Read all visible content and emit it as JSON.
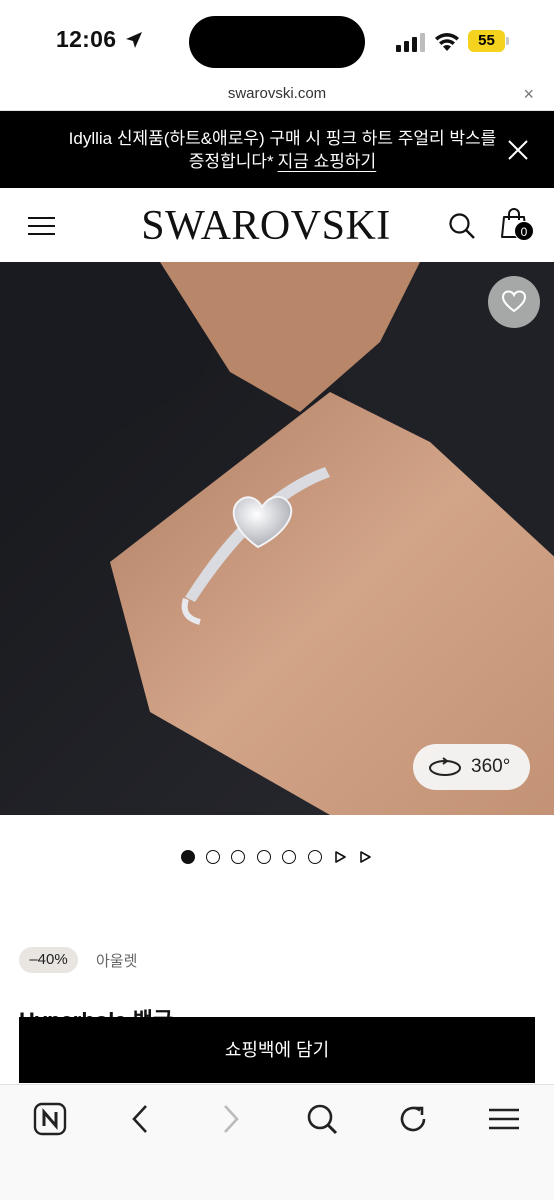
{
  "status_bar": {
    "time": "12:06",
    "battery_level": "55",
    "icons": [
      "location-arrow-icon",
      "cellular-signal-icon",
      "wifi-icon",
      "battery-icon"
    ]
  },
  "browser": {
    "url": "swarovski.com",
    "close_glyph": "×"
  },
  "promo_banner": {
    "message": "Idyllia 신제품(하트&애로우) 구매 시 핑크 하트 주얼리 박스를 증정합니다*",
    "link_label": "지금 쇼핑하기"
  },
  "header": {
    "logo": "SWAROVSKI",
    "bag_count": "0"
  },
  "hero": {
    "rotate_label": "360°",
    "colors": {
      "background": "#1c1d22",
      "skin": "#c99a7e"
    }
  },
  "carousel": {
    "total_dots": 6,
    "active_index": 0
  },
  "product": {
    "discount_badge": "–40%",
    "category": "아울렛",
    "name": "Hyperbola 뱅글"
  },
  "cta": {
    "add_to_bag_label": "쇼핑백에 담기"
  },
  "colors": {
    "banner_bg": "#000000",
    "badge_bg": "#e9e6e1",
    "cta_bg": "#000000"
  }
}
